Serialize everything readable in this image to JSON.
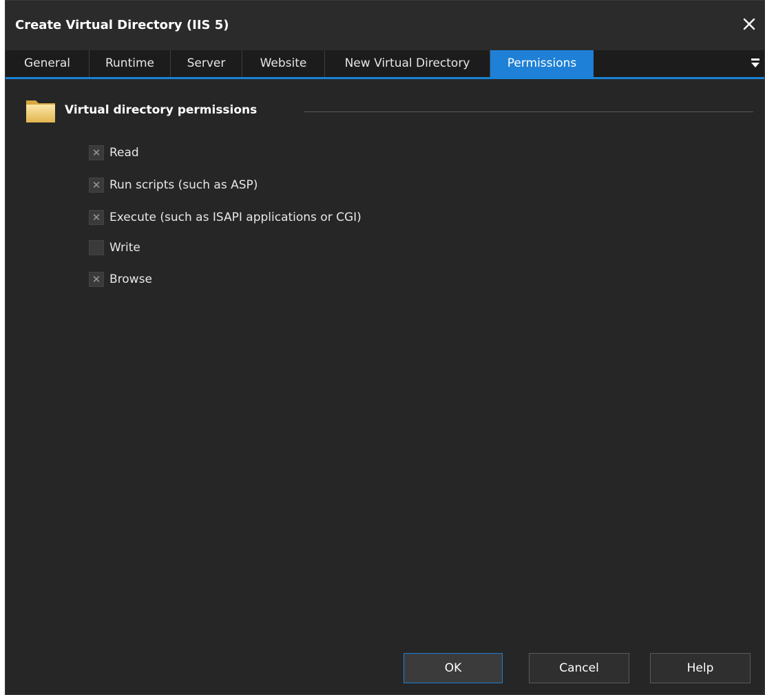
{
  "window": {
    "title": "Create Virtual Directory (IIS 5)"
  },
  "tabs": [
    {
      "label": "General",
      "active": false
    },
    {
      "label": "Runtime",
      "active": false
    },
    {
      "label": "Server",
      "active": false
    },
    {
      "label": "Website",
      "active": false
    },
    {
      "label": "New Virtual Directory",
      "active": false
    },
    {
      "label": "Permissions",
      "active": true
    }
  ],
  "group": {
    "title": "Virtual directory permissions",
    "icon": "folder-icon"
  },
  "permissions": [
    {
      "label": "Read",
      "checked": true
    },
    {
      "label": "Run scripts (such as ASP)",
      "checked": true
    },
    {
      "label": "Execute (such as ISAPI applications or CGI)",
      "checked": true
    },
    {
      "label": "Write",
      "checked": false
    },
    {
      "label": "Browse",
      "checked": true
    }
  ],
  "buttons": {
    "ok": "OK",
    "cancel": "Cancel",
    "help": "Help"
  },
  "colors": {
    "background": "#262626",
    "accent": "#1e80d6",
    "tab_bar": "#1c1c1c",
    "text": "#ffffff"
  }
}
